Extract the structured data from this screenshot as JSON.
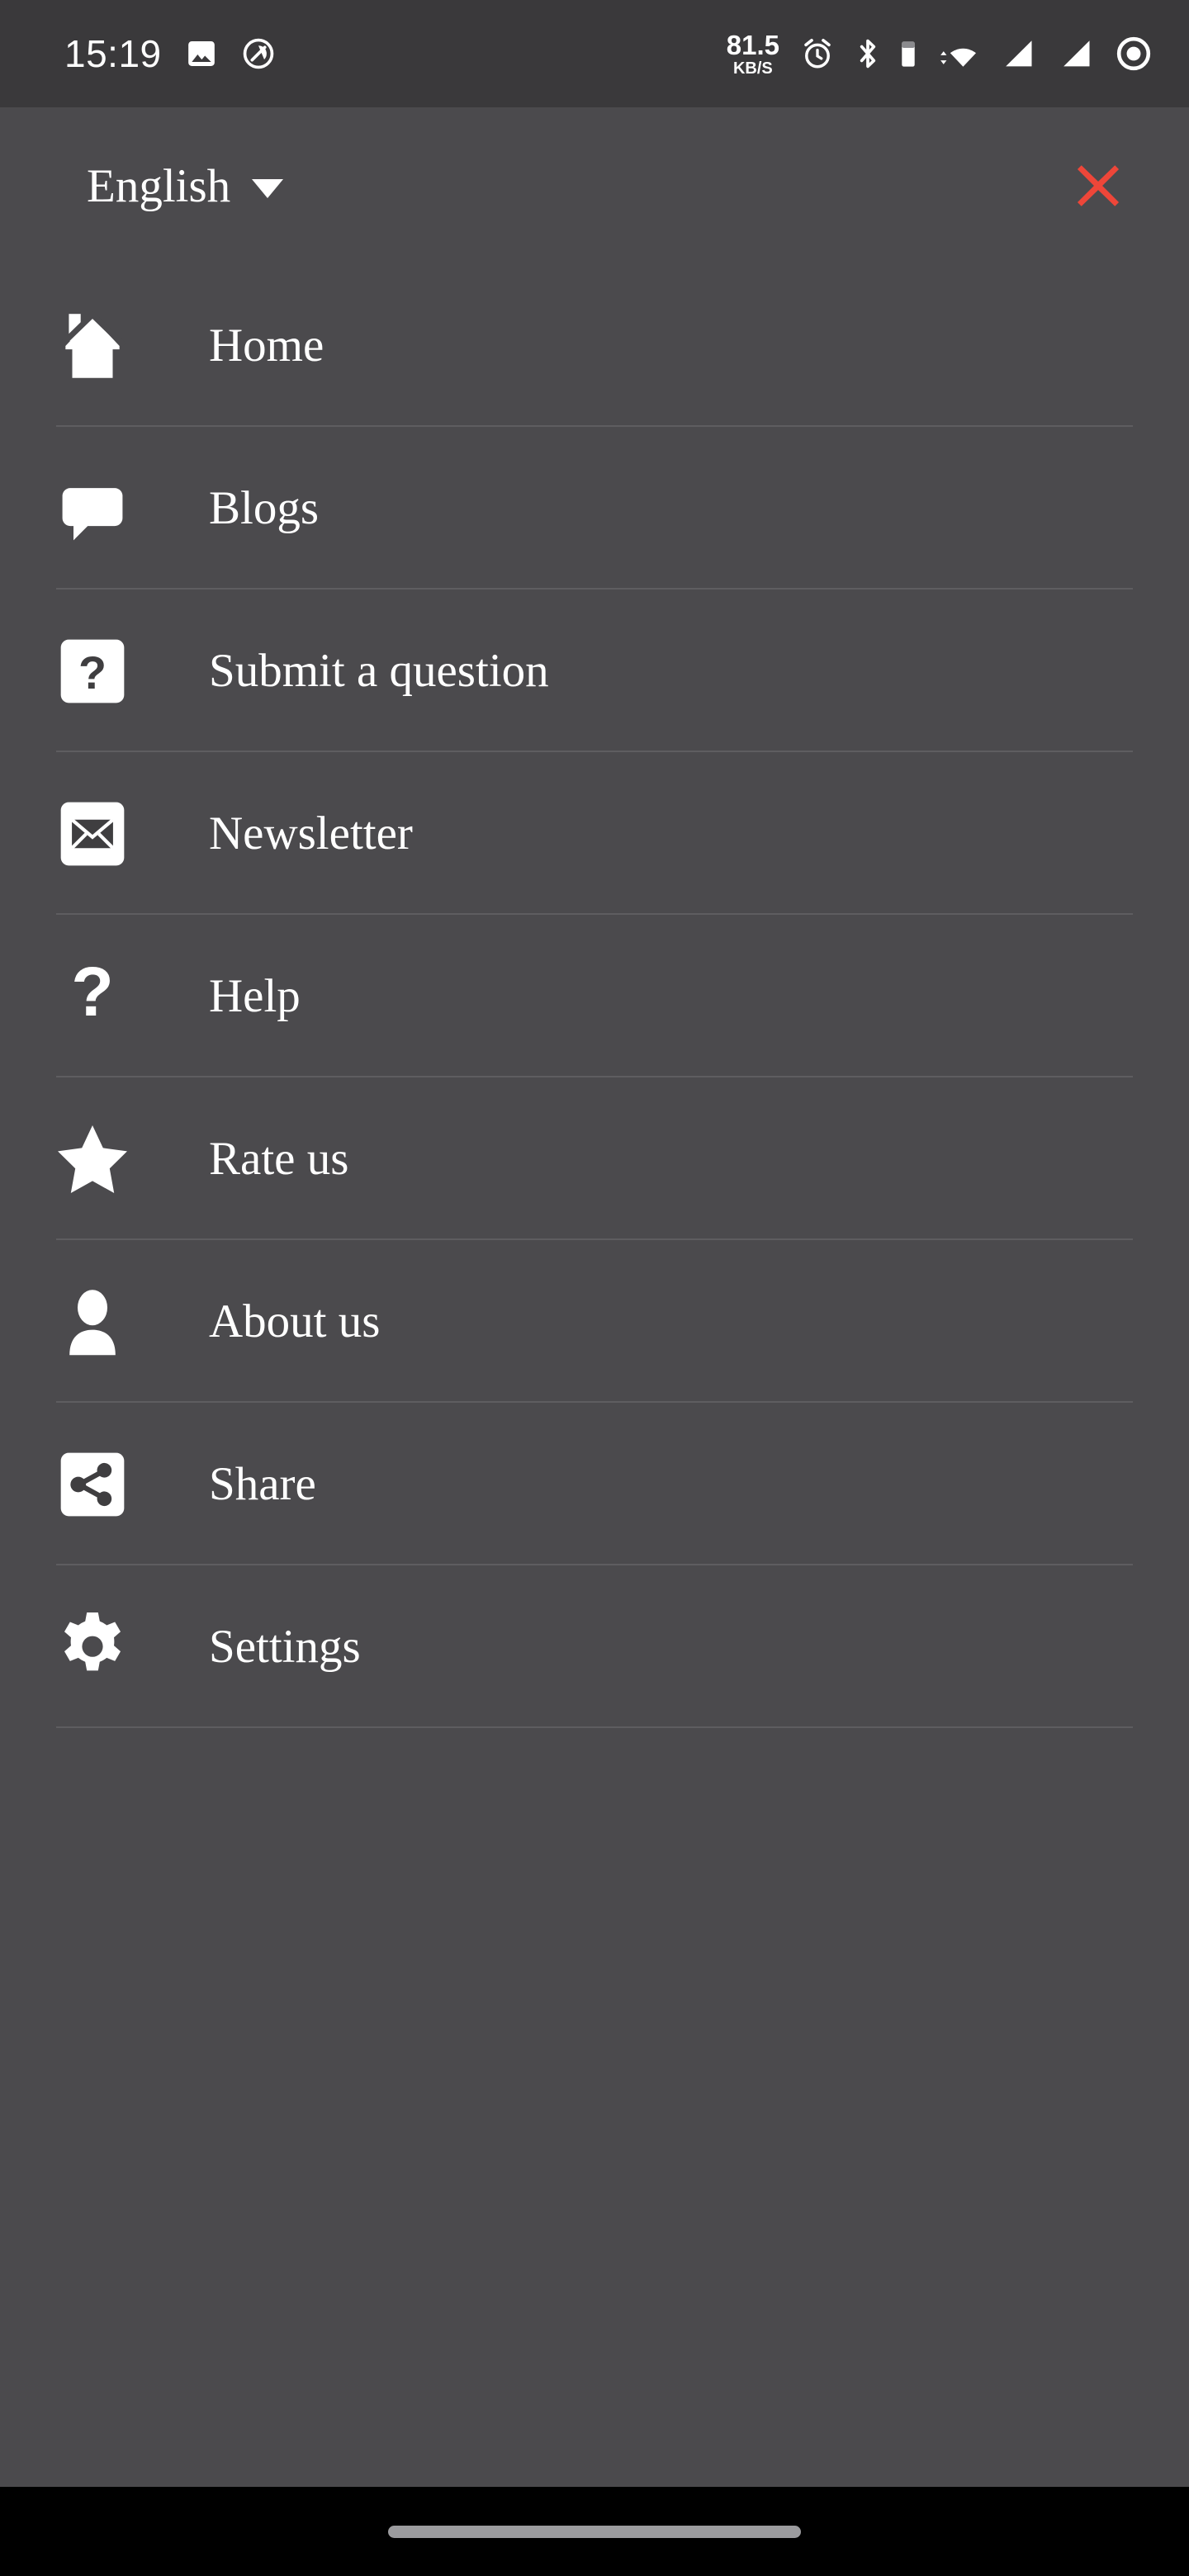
{
  "status_bar": {
    "clock": "15:19",
    "icons_left": [
      "image-icon",
      "do-not-disturb-icon"
    ],
    "network_speed_value": "81.5",
    "network_speed_unit": "KB/S",
    "icons_right": [
      "alarm-icon",
      "bluetooth-icon",
      "battery-icon",
      "wifi-icon",
      "signal-sim1-icon",
      "signal-sim2-icon",
      "screen-record-icon"
    ],
    "background_color": "#3a393b"
  },
  "header": {
    "language_label": "English",
    "language_caret": "chevron-down-icon",
    "close_label": "close-icon",
    "close_color": "#ee4639"
  },
  "menu": {
    "items": [
      {
        "label": "Home",
        "icon": "home-icon"
      },
      {
        "label": "Blogs",
        "icon": "speech-bubble-icon"
      },
      {
        "label": "Submit a question",
        "icon": "question-box-icon"
      },
      {
        "label": "Newsletter",
        "icon": "envelope-box-icon"
      },
      {
        "label": "Help",
        "icon": "question-mark-icon"
      },
      {
        "label": "Rate us",
        "icon": "star-icon"
      },
      {
        "label": "About us",
        "icon": "person-icon"
      },
      {
        "label": "Share",
        "icon": "share-box-icon"
      },
      {
        "label": "Settings",
        "icon": "gear-icon"
      }
    ]
  },
  "nav_bar": {
    "home_indicator": "home-indicator",
    "background_color": "#000000"
  },
  "theme": {
    "drawer_background": "#4b4a4d",
    "divider_color": "#5e5d60",
    "text_color": "#ffffff",
    "accent_color": "#ee4639"
  }
}
